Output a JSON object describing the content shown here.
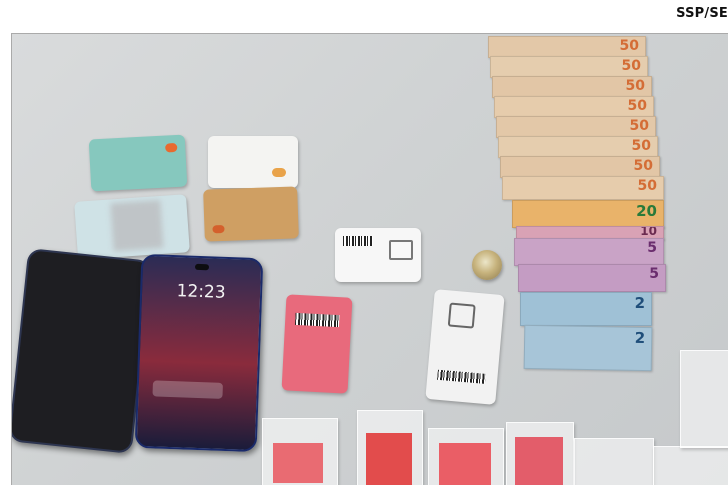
{
  "credit": "SSP/SE",
  "phone_clock": "12:23",
  "banknote_values": [
    "50",
    "50",
    "50",
    "50",
    "50",
    "50",
    "50",
    "50",
    "20",
    "10",
    "5",
    "5",
    "2",
    "2"
  ]
}
